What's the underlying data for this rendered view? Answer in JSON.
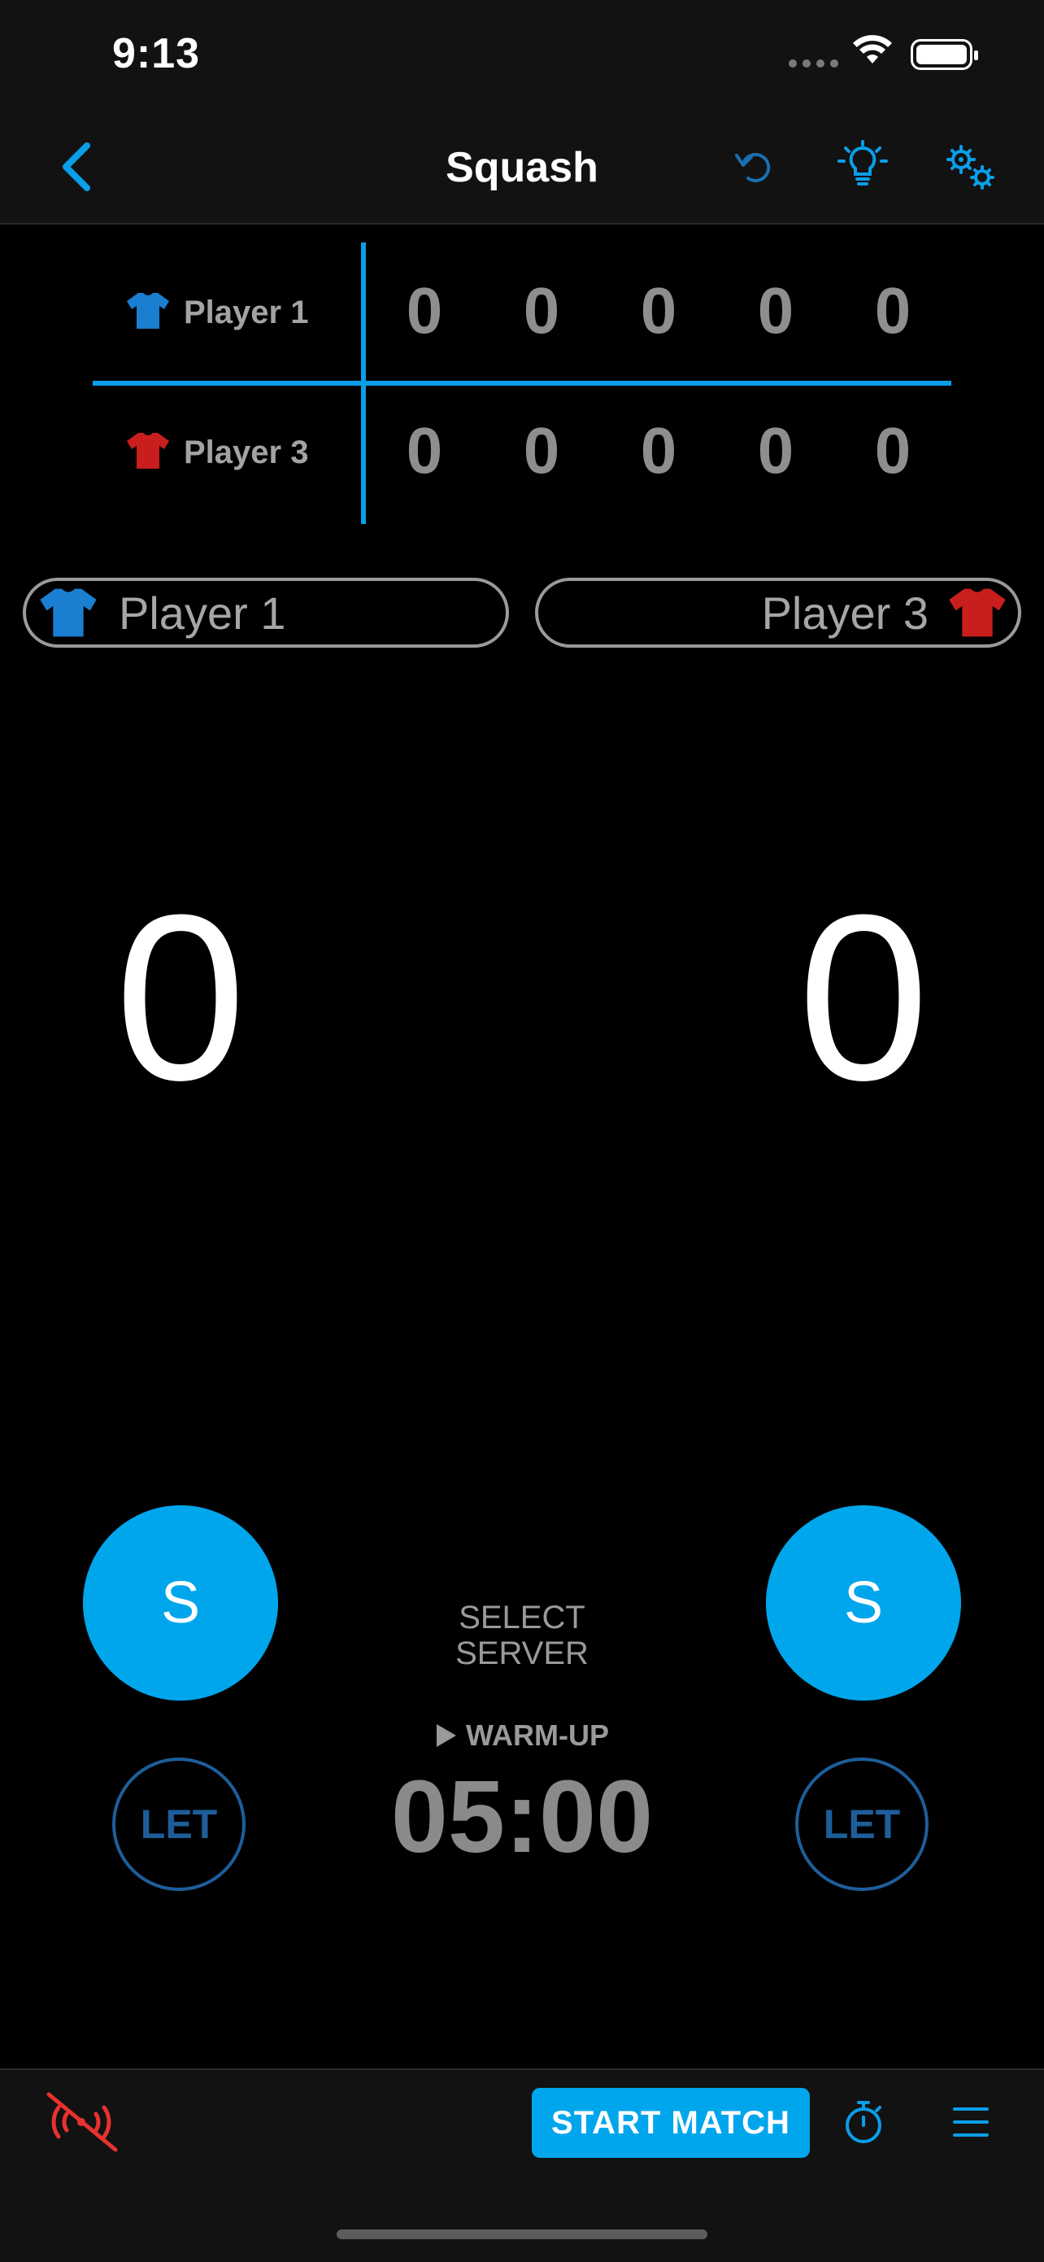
{
  "status_bar": {
    "time": "9:13"
  },
  "nav": {
    "title": "Squash"
  },
  "scoreboard": {
    "rows": [
      {
        "player": "Player 1",
        "shirt_color": "#1a7fd1",
        "sets": [
          "0",
          "0",
          "0",
          "0",
          "0"
        ]
      },
      {
        "player": "Player 3",
        "shirt_color": "#c81e1e",
        "sets": [
          "0",
          "0",
          "0",
          "0",
          "0"
        ]
      }
    ]
  },
  "players": {
    "left": {
      "name": "Player 1",
      "shirt_color": "#1a7fd1"
    },
    "right": {
      "name": "Player 3",
      "shirt_color": "#c81e1e"
    }
  },
  "scores": {
    "left": "0",
    "right": "0"
  },
  "serve": {
    "left_label": "S",
    "right_label": "S",
    "hint": "SELECT SERVER"
  },
  "timer": {
    "mode": "WARM-UP",
    "value": "05:00"
  },
  "let": {
    "left_label": "LET",
    "right_label": "LET"
  },
  "bottom": {
    "start_label": "START MATCH"
  },
  "colors": {
    "accent": "#00a6ec",
    "line": "#0a9ee8",
    "danger": "#e8322f"
  },
  "icons": [
    "back-chevron-icon",
    "undo-icon",
    "lightbulb-icon",
    "settings-gears-icon",
    "sound-off-icon",
    "stopwatch-icon",
    "menu-icon",
    "play-icon",
    "tshirt-icon"
  ]
}
